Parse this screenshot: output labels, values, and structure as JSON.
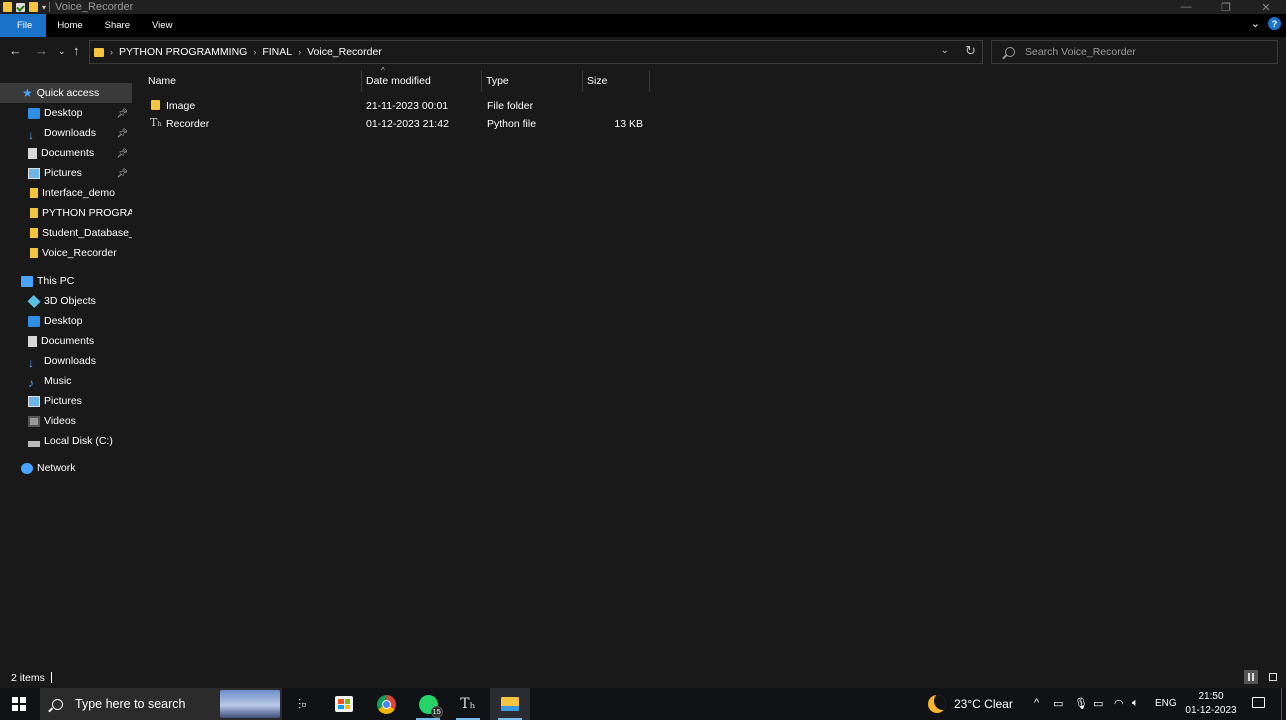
{
  "window": {
    "title": "Voice_Recorder"
  },
  "ribbon": {
    "tabs": [
      "File",
      "Home",
      "Share",
      "View"
    ]
  },
  "address": {
    "crumbs": [
      "PYTHON PROGRAMMING",
      "FINAL",
      "Voice_Recorder"
    ],
    "search_placeholder": "Search Voice_Recorder"
  },
  "sidebar": {
    "quick_access": {
      "label": "Quick access",
      "items": [
        {
          "label": "Desktop",
          "icon": "desktop-icon",
          "pinned": true
        },
        {
          "label": "Downloads",
          "icon": "downloads-icon",
          "pinned": true
        },
        {
          "label": "Documents",
          "icon": "documents-icon",
          "pinned": true
        },
        {
          "label": "Pictures",
          "icon": "pictures-icon",
          "pinned": true
        },
        {
          "label": "Interface_demo",
          "icon": "folder-icon",
          "pinned": false
        },
        {
          "label": "PYTHON PROGRAMMING",
          "icon": "folder-icon",
          "pinned": false
        },
        {
          "label": "Student_Database_N",
          "icon": "folder-icon",
          "pinned": false
        },
        {
          "label": "Voice_Recorder",
          "icon": "folder-icon",
          "pinned": false
        }
      ]
    },
    "this_pc": {
      "label": "This PC",
      "items": [
        {
          "label": "3D Objects",
          "icon": "3d-objects-icon"
        },
        {
          "label": "Desktop",
          "icon": "desktop-icon"
        },
        {
          "label": "Documents",
          "icon": "documents-icon"
        },
        {
          "label": "Downloads",
          "icon": "downloads-icon"
        },
        {
          "label": "Music",
          "icon": "music-icon"
        },
        {
          "label": "Pictures",
          "icon": "pictures-icon"
        },
        {
          "label": "Videos",
          "icon": "videos-icon"
        },
        {
          "label": "Local Disk (C:)",
          "icon": "local-disk-icon"
        }
      ]
    },
    "network": {
      "label": "Network"
    }
  },
  "columns": {
    "name": "Name",
    "date": "Date modified",
    "type": "Type",
    "size": "Size"
  },
  "files": [
    {
      "name": "Image",
      "date": "21-11-2023 00:01",
      "type": "File folder",
      "size": "",
      "icon": "folder-icon"
    },
    {
      "name": "Recorder",
      "date": "01-12-2023 21:42",
      "type": "Python file",
      "size": "13 KB",
      "icon": "python-file-icon"
    }
  ],
  "status": {
    "items": "2 items"
  },
  "taskbar": {
    "search_text": "Type here to search",
    "whatsapp_badge": "15",
    "weather": "23°C  Clear",
    "language": "ENG",
    "time": "21:50",
    "date": "01-12-2023"
  },
  "colors": {
    "accent": "#1a73c8",
    "background": "#191919",
    "folder": "#f5c542"
  }
}
